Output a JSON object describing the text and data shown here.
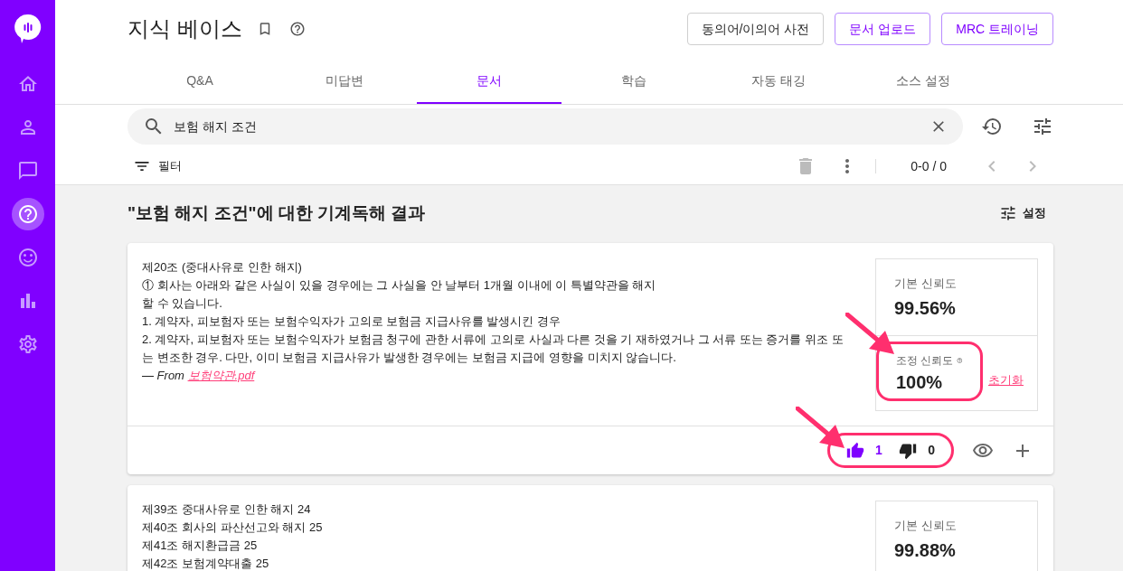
{
  "sidebar": {
    "items": [
      {
        "kind": "home",
        "selected": false
      },
      {
        "kind": "user",
        "selected": false
      },
      {
        "kind": "chat",
        "selected": false
      },
      {
        "kind": "help",
        "selected": true
      },
      {
        "kind": "smile",
        "selected": false
      },
      {
        "kind": "chart",
        "selected": false
      },
      {
        "kind": "settings",
        "selected": false
      }
    ]
  },
  "header": {
    "title": "지식 베이스",
    "buttons": [
      {
        "label": "동의어/이의어 사전",
        "kind": "plain"
      },
      {
        "label": "문서 업로드",
        "kind": "accent"
      },
      {
        "label": "MRC 트레이닝",
        "kind": "accent"
      }
    ]
  },
  "tabs": [
    {
      "label": "Q&A",
      "selected": false
    },
    {
      "label": "미답변",
      "selected": false
    },
    {
      "label": "문서",
      "selected": true
    },
    {
      "label": "학습",
      "selected": false
    },
    {
      "label": "자동 태깅",
      "selected": false
    },
    {
      "label": "소스 설정",
      "selected": false
    }
  ],
  "search": {
    "value": "보험 해지 조건"
  },
  "toolbar": {
    "filter_label": "필터",
    "page_range": "0-0 / 0"
  },
  "results": {
    "heading": "\"보험 해지 조건\"에 대한 기계독해 결과",
    "settings_label": "설정",
    "cards": [
      {
        "lines": [
          "제20조 (중대사유로 인한 해지)",
          "① 회사는 아래와 같은 사실이 있을 경우에는 그 사실을 안 날부터 1개월 이내에 이 특별약관을 해지",
          "할 수 있습니다.",
          "1. 계약자, 피보험자 또는 보험수익자가 고의로 보험금 지급사유를 발생시킨 경우",
          "2. 계약자, 피보험자 또는 보험수익자가 보험금 청구에 관한 서류에 고의로 사실과 다른 것을 기 재하였거나 그 서류 또는 증거를 위조 또",
          "는 변조한 경우. 다만, 이미 보험금 지급사유가 발생한 경우에는 보험금 지급에 영향을 미치지 않습니다."
        ],
        "source_prefix": "— From",
        "source_link": "보험약관.pdf",
        "base_label": "기본 신뢰도",
        "base_value": "99.56%",
        "adjusted": {
          "label": "조정 신뢰도",
          "value": "100%",
          "reset": "초기화",
          "highlighted": true
        },
        "votes": {
          "highlighted": true,
          "items": [
            {
              "kind": "up",
              "count": "1",
              "selected": true
            },
            {
              "kind": "down",
              "count": "0",
              "selected": false
            }
          ]
        }
      },
      {
        "lines": [
          "제39조 중대사유로 인한 해지 24",
          "제40조 회사의 파산선고와 해지 25",
          "제41조 해지환급금 25",
          "제42조 보험계약대출 25"
        ],
        "base_label": "기본 신뢰도",
        "base_value": "99.88%"
      }
    ]
  }
}
